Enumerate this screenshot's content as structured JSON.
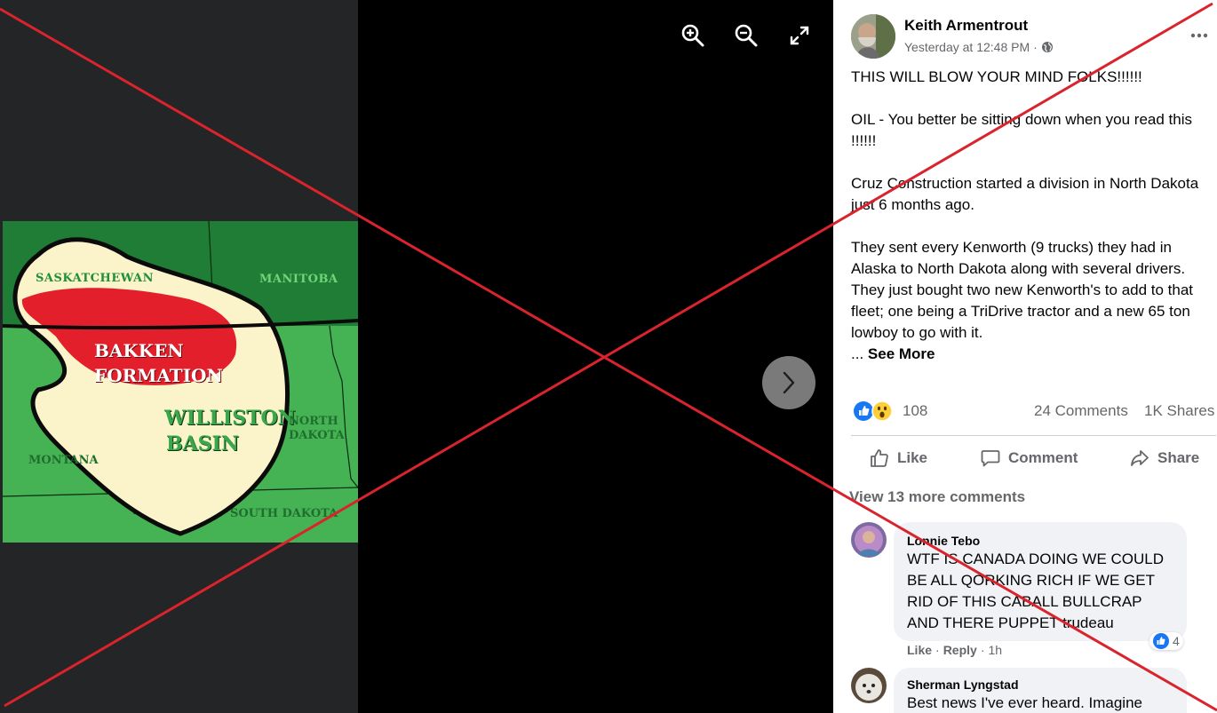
{
  "viewer": {
    "icons": {
      "zoom_in": "zoom-in-icon",
      "zoom_out": "zoom-out-icon",
      "fullscreen": "fullscreen-icon",
      "next": "chevron-right-icon"
    },
    "map": {
      "labels": {
        "saskatchewan": "SASKATCHEWAN",
        "manitoba": "MANITOBA",
        "bakken_1": "BAKKEN",
        "bakken_2": "FORMATION",
        "williston_1": "WILLISTON",
        "williston_2": "BASIN",
        "north_dakota_1": "NORTH",
        "north_dakota_2": "DAKOTA",
        "montana": "MONTANA",
        "south_dakota": "SOUTH DAKOTA"
      },
      "colors": {
        "green": "#3aa84a",
        "dark_green": "#1f7d36",
        "cream": "#fbf3c9",
        "red": "#e21f2b"
      }
    }
  },
  "post": {
    "author": "Keith Armentrout",
    "timestamp": "Yesterday at 12:48 PM",
    "audience_icon": "globe-icon",
    "paragraphs": [
      "THIS WILL BLOW YOUR MIND FOLKS!!!!!!",
      "OIL - You better be sitting down when you read this !!!!!!",
      "Cruz Construction started a division in North Dakota just 6 months ago.",
      "They sent every Kenworth (9 trucks) they had in Alaska to North Dakota along with several drivers. They just bought two new Kenworth's to add to that fleet; one being a TriDrive tractor and a new 65 ton lowboy to go with it."
    ],
    "ellipsis": "...",
    "see_more": "See More",
    "reactions": {
      "count": "108",
      "icons": [
        "like-icon",
        "wow-icon"
      ]
    },
    "comments_count": "24 Comments",
    "shares_count": "1K Shares",
    "actions": {
      "like": "Like",
      "comment": "Comment",
      "share": "Share"
    },
    "view_more_comments": "View 13 more comments",
    "comments": [
      {
        "author": "Lonnie Tebo",
        "text": "WTF IS CANADA DOING WE COULD BE ALL QORKING RICH IF WE GET RID OF THIS CABALL BULLCRAP AND THERE PUPPET trudeau",
        "like": "Like",
        "reply": "Reply",
        "time": "1h",
        "reactions": "4"
      },
      {
        "author": "Sherman Lyngstad",
        "text": "Best news I've ever heard. Imagine"
      }
    ]
  },
  "colors": {
    "cross": "#d9232d",
    "secondary_text": "#65676b",
    "like_blue": "#1877f2"
  }
}
